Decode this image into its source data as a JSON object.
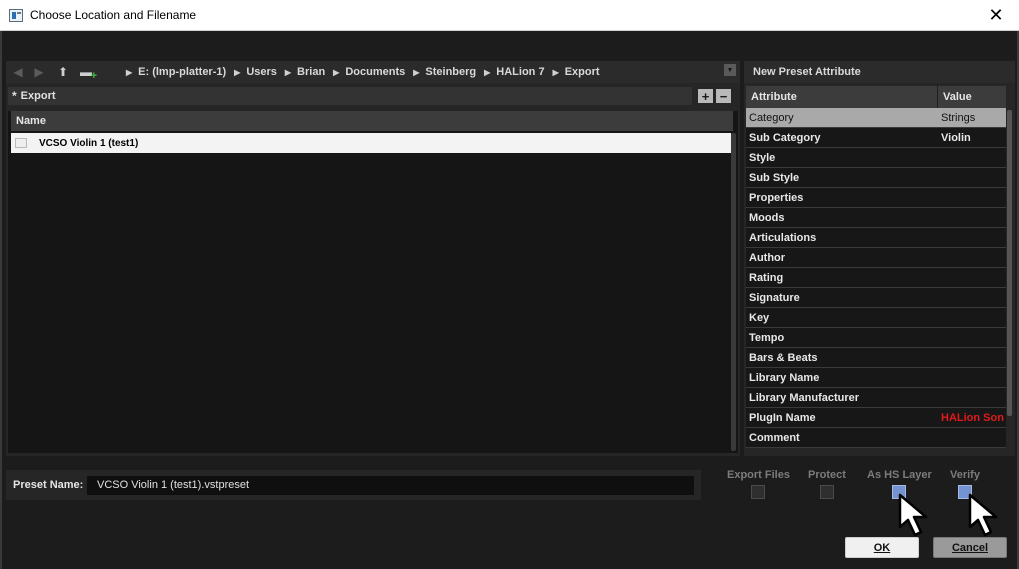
{
  "window": {
    "title": "Choose Location and Filename",
    "close_glyph": "✕"
  },
  "nav": {
    "back_icon": "arrow-left-icon",
    "forward_icon": "arrow-right-icon",
    "up_icon": "arrow-up-icon",
    "new_folder_icon": "new-folder-icon",
    "breadcrumb": [
      "E: (lmp-platter-1)",
      "Users",
      "Brian",
      "Documents",
      "Steinberg",
      "HALion 7",
      "Export"
    ]
  },
  "filter": {
    "value": "Export",
    "add_label": "+",
    "remove_label": "−"
  },
  "file_list": {
    "header": "Name",
    "rows": [
      {
        "name": "VCSO Violin 1 (test1)"
      }
    ]
  },
  "attributes_panel": {
    "title": "New Preset Attribute",
    "columns": [
      "Attribute",
      "Value"
    ],
    "rows": [
      {
        "attribute": "Category",
        "value": "Strings",
        "selected": true
      },
      {
        "attribute": "Sub Category",
        "value": "Violin"
      },
      {
        "attribute": "Style",
        "value": ""
      },
      {
        "attribute": "Sub Style",
        "value": ""
      },
      {
        "attribute": "Properties",
        "value": ""
      },
      {
        "attribute": "Moods",
        "value": ""
      },
      {
        "attribute": "Articulations",
        "value": ""
      },
      {
        "attribute": "Author",
        "value": ""
      },
      {
        "attribute": "Rating",
        "value": ""
      },
      {
        "attribute": "Signature",
        "value": ""
      },
      {
        "attribute": "Key",
        "value": ""
      },
      {
        "attribute": "Tempo",
        "value": ""
      },
      {
        "attribute": "Bars & Beats",
        "value": ""
      },
      {
        "attribute": "Library Name",
        "value": ""
      },
      {
        "attribute": "Library Manufacturer",
        "value": ""
      },
      {
        "attribute": "PlugIn Name",
        "value": "HALion Soni",
        "color": "#e01a1a"
      },
      {
        "attribute": "Comment",
        "value": ""
      }
    ]
  },
  "preset": {
    "label": "Preset Name:",
    "value": "VCSO Violin 1 (test1).vstpreset"
  },
  "options": [
    {
      "label": "Export Files",
      "checked": false
    },
    {
      "label": "Protect",
      "checked": false
    },
    {
      "label": "As HS Layer",
      "checked": true
    },
    {
      "label": "Verify",
      "checked": true
    }
  ],
  "buttons": {
    "ok": "OK",
    "cancel": "Cancel"
  },
  "colors": {
    "checkbox_on": "#7393d3",
    "plugin_name_value": "#e01a1a",
    "selected_row": "#a9a9a9"
  }
}
